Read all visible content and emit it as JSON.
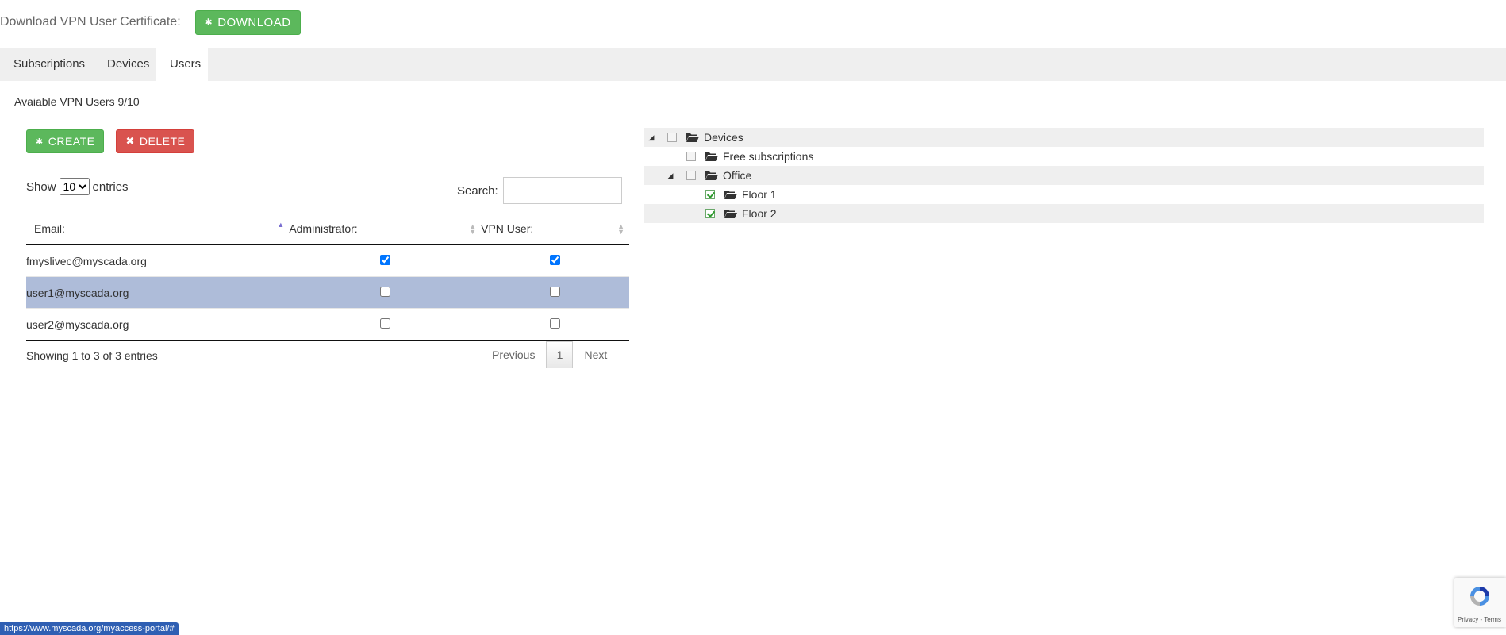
{
  "certificate": {
    "label": "Download VPN User Certificate:",
    "download_label": "DOWNLOAD"
  },
  "tabs": [
    {
      "label": "Subscriptions",
      "active": false
    },
    {
      "label": "Devices",
      "active": false
    },
    {
      "label": "Users",
      "active": true
    }
  ],
  "available_users": "Avaiable VPN Users 9/10",
  "actions": {
    "create_label": "CREATE",
    "delete_label": "DELETE"
  },
  "length_menu": {
    "show_label": "Show",
    "selected": "10",
    "entries_label": "entries"
  },
  "search": {
    "label": "Search:",
    "value": ""
  },
  "table": {
    "columns": [
      "Email:",
      "Administrator:",
      "VPN User:"
    ],
    "rows": [
      {
        "email": "fmyslivec@myscada.org",
        "administrator": true,
        "vpn_user": true,
        "selected": false
      },
      {
        "email": "user1@myscada.org",
        "administrator": false,
        "vpn_user": false,
        "selected": true
      },
      {
        "email": "user2@myscada.org",
        "administrator": false,
        "vpn_user": false,
        "selected": false
      }
    ]
  },
  "table_info": "Showing 1 to 3 of 3 entries",
  "pagination": {
    "previous": "Previous",
    "current": "1",
    "next": "Next"
  },
  "tree": [
    {
      "label": "Devices",
      "expanded": true,
      "checked": false
    },
    {
      "label": "Free subscriptions",
      "checked": false
    },
    {
      "label": "Office",
      "expanded": true,
      "checked": false
    },
    {
      "label": "Floor 1",
      "checked": true
    },
    {
      "label": "Floor 2",
      "checked": true
    }
  ],
  "statusbar_url": "https://www.myscada.org/myaccess-portal/#",
  "recaptcha": {
    "links": "Privacy - Terms"
  },
  "colors": {
    "green": "#5cb85c",
    "red": "#d9534f",
    "selected_row": "#aebcd9",
    "status_blue": "#2f5fb3"
  }
}
